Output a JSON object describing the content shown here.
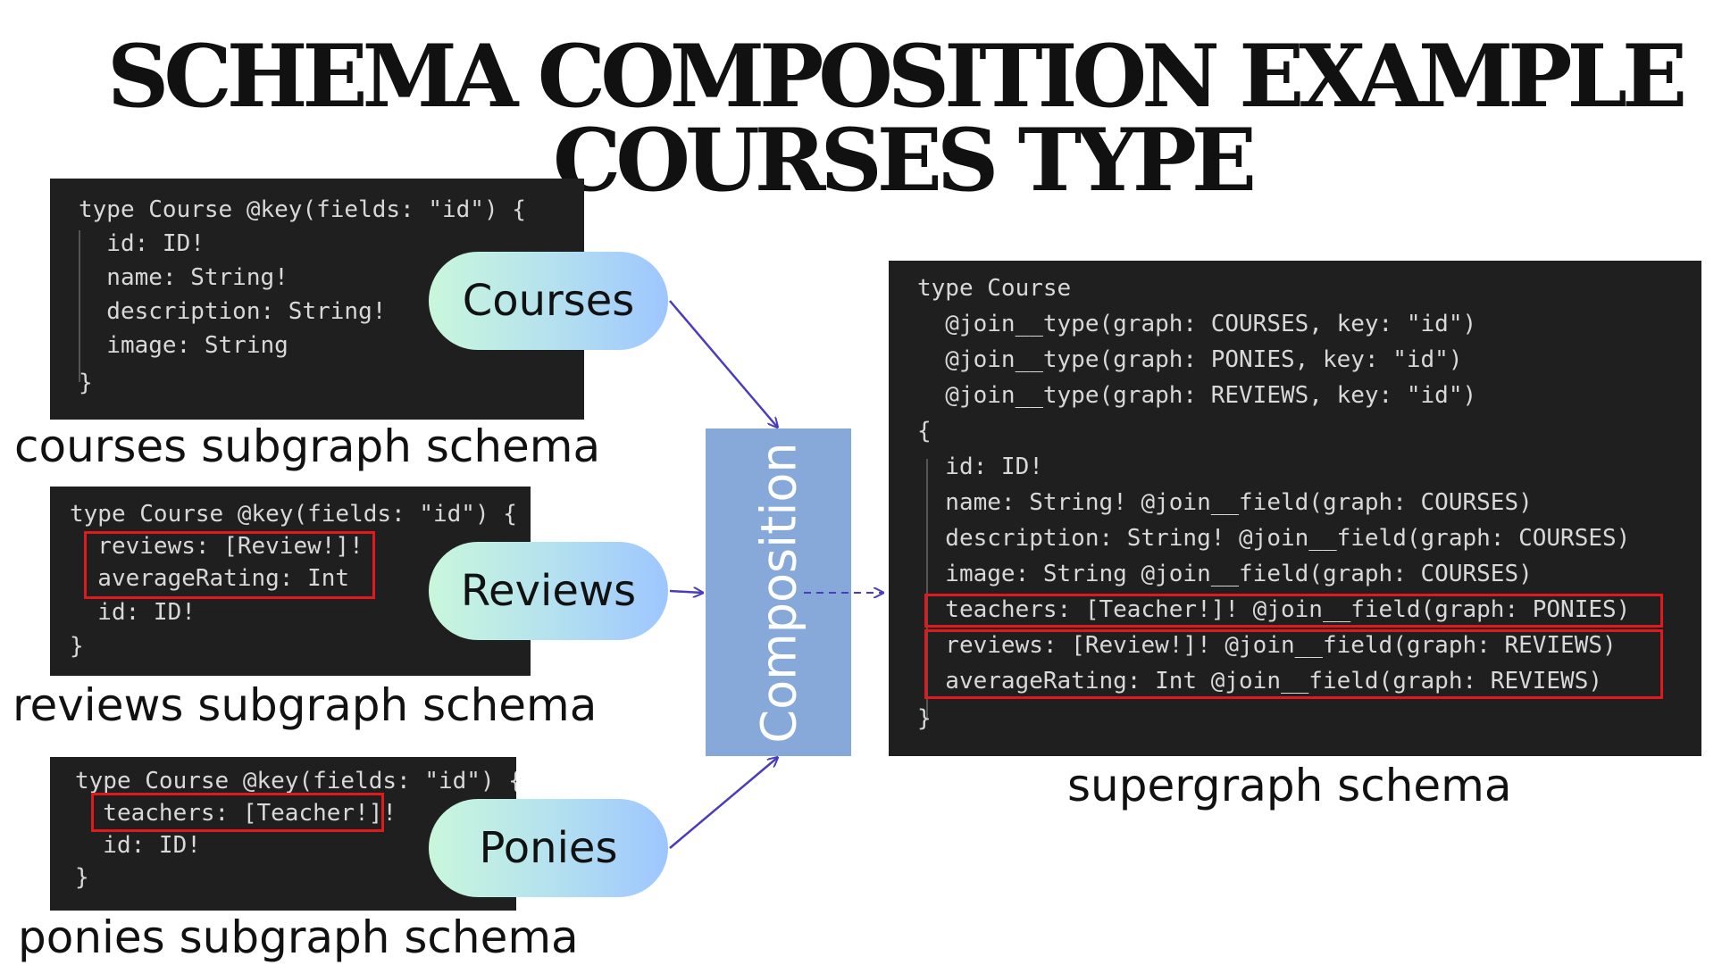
{
  "title": {
    "line1": "SCHEMA COMPOSITION EXAMPLE",
    "line2": "COURSES TYPE"
  },
  "subgraphs": {
    "courses": {
      "pill_label": "Courses",
      "caption": "courses subgraph schema",
      "code": [
        "type Course @key(fields: \"id\") {",
        "  id: ID!",
        "  name: String!",
        "  description: String!",
        "  image: String",
        "}"
      ]
    },
    "reviews": {
      "pill_label": "Reviews",
      "caption": "reviews subgraph schema",
      "code": [
        "type Course @key(fields: \"id\") {",
        "  reviews: [Review!]!",
        "  averageRating: Int",
        "  id: ID!",
        "}"
      ]
    },
    "ponies": {
      "pill_label": "Ponies",
      "caption": "ponies subgraph schema",
      "code": [
        "type Course @key(fields: \"id\") {",
        "  teachers: [Teacher!]!",
        "  id: ID!",
        "}"
      ]
    }
  },
  "composition_label": "Composition",
  "supergraph": {
    "caption": "supergraph schema",
    "code": [
      "type Course",
      "  @join__type(graph: COURSES, key: \"id\")",
      "  @join__type(graph: PONIES, key: \"id\")",
      "  @join__type(graph: REVIEWS, key: \"id\")",
      "{",
      "  id: ID!",
      "  name: String! @join__field(graph: COURSES)",
      "  description: String! @join__field(graph: COURSES)",
      "  image: String @join__field(graph: COURSES)",
      "  teachers: [Teacher!]! @join__field(graph: PONIES)",
      "  reviews: [Review!]! @join__field(graph: REVIEWS)",
      "  averageRating: Int @join__field(graph: REVIEWS)",
      "}"
    ]
  },
  "colors": {
    "code_bg": "#1f1f1f",
    "highlight": "#e01a1a",
    "composition_box": "#86a9d9",
    "arrow": "#4b3bbf"
  }
}
